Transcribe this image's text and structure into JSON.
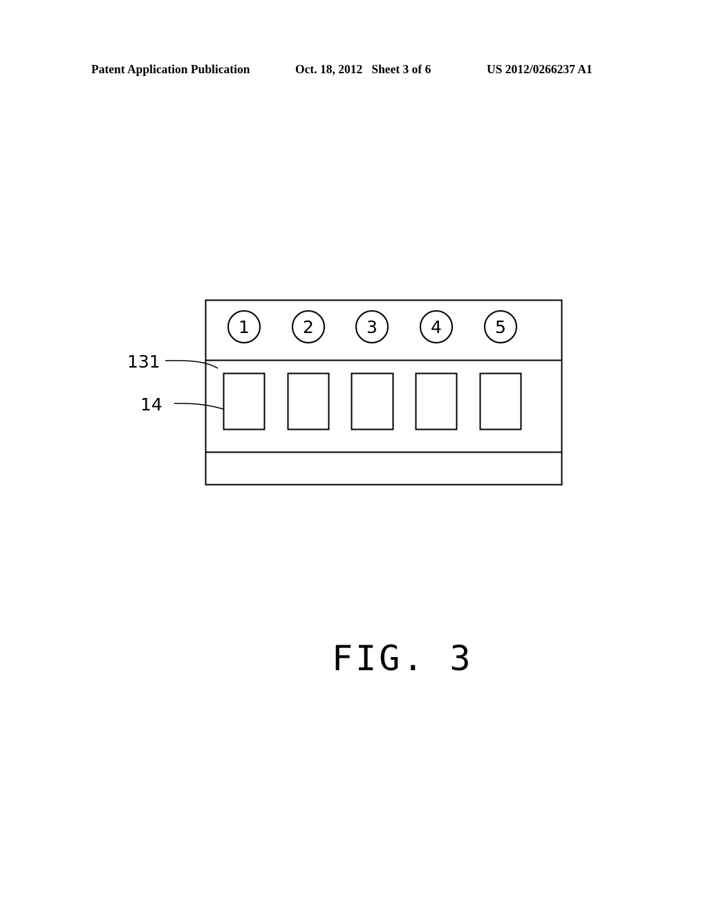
{
  "header": {
    "left": "Patent Application Publication",
    "middle": "Oct. 18, 2012   Sheet 3 of 6",
    "right": "US 2012/0266237 A1"
  },
  "figure": {
    "caption": "FIG. 3",
    "circle_labels": [
      "1",
      "2",
      "3",
      "4",
      "5"
    ],
    "reference_labels": {
      "band": "131",
      "box": "14"
    },
    "box_count": 5
  }
}
